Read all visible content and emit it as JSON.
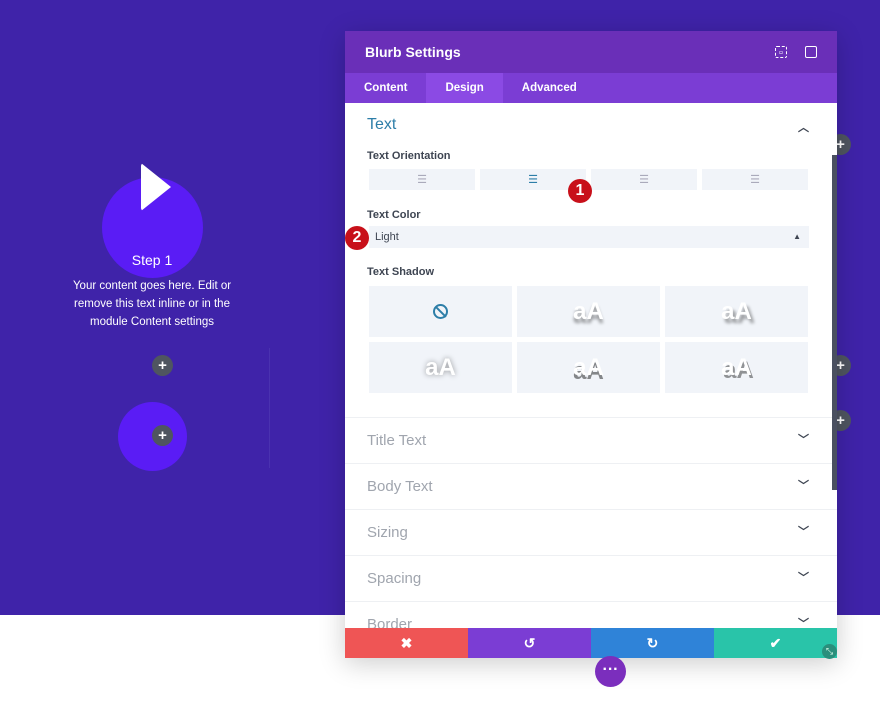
{
  "colors": {
    "background": "#3f23a9",
    "accent": "#2d7ea8",
    "cancel": "#ef5555",
    "undo": "#7b3dd4",
    "redo": "#2f83d8",
    "save": "#29c4a9"
  },
  "blurb": {
    "title": "Step 1",
    "description": "Your content goes here. Edit or remove this text inline or in the module Content settings",
    "icon": "play-icon"
  },
  "panel": {
    "title": "Blurb Settings",
    "tabs": [
      {
        "label": "Content"
      },
      {
        "label": "Design",
        "active": true
      },
      {
        "label": "Advanced"
      }
    ],
    "text_section": {
      "title": "Text",
      "orientation_label": "Text Orientation",
      "orientation_options": [
        "left",
        "center",
        "right",
        "justify"
      ],
      "orientation_selected": "center",
      "color_label": "Text Color",
      "color_value": "Light",
      "shadow_label": "Text Shadow",
      "shadow_sample": "aA"
    },
    "sections": [
      {
        "label": "Title Text"
      },
      {
        "label": "Body Text"
      },
      {
        "label": "Sizing"
      },
      {
        "label": "Spacing"
      },
      {
        "label": "Border"
      }
    ]
  },
  "badges": [
    "1",
    "2"
  ],
  "footer": {
    "cancel": "✖",
    "undo": "↺",
    "redo": "↻",
    "save": "✔"
  },
  "more": "···"
}
